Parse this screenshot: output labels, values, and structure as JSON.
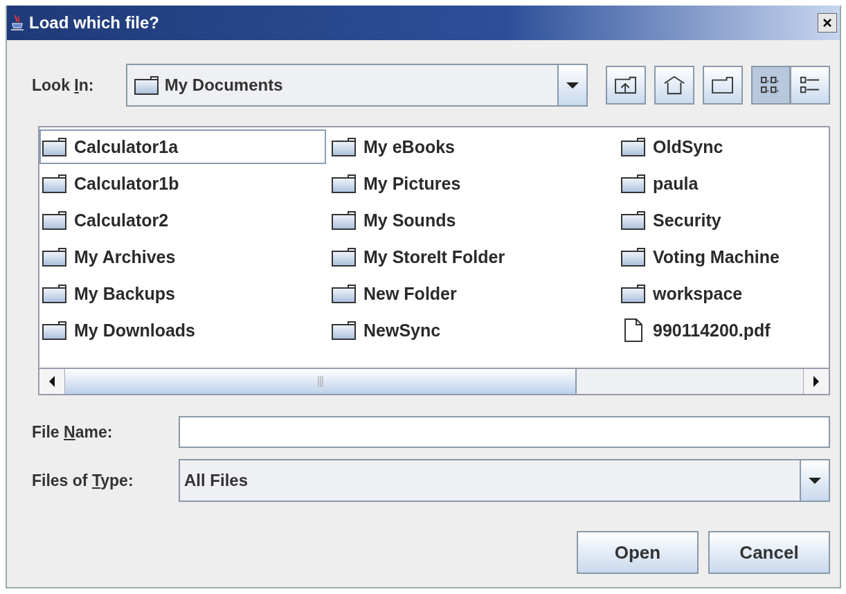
{
  "window": {
    "title": "Load which file?"
  },
  "look_in": {
    "label": {
      "before": "Look ",
      "key": "I",
      "after": "n:"
    },
    "value": "My Documents"
  },
  "toolbar": [
    {
      "kind": "up"
    },
    {
      "kind": "home"
    },
    {
      "kind": "new-folder"
    },
    {
      "kind": "list",
      "selected": true
    },
    {
      "kind": "details",
      "selected": false
    }
  ],
  "files": [
    {
      "name": "Calculator1a",
      "kind": "folder",
      "selected": true
    },
    {
      "name": "Calculator1b",
      "kind": "folder",
      "selected": false
    },
    {
      "name": "Calculator2",
      "kind": "folder",
      "selected": false
    },
    {
      "name": "My Archives",
      "kind": "folder",
      "selected": false
    },
    {
      "name": "My Backups",
      "kind": "folder",
      "selected": false
    },
    {
      "name": "My Downloads",
      "kind": "folder",
      "selected": false
    },
    {
      "name": "My eBooks",
      "kind": "folder",
      "selected": false
    },
    {
      "name": "My Pictures",
      "kind": "folder",
      "selected": false
    },
    {
      "name": "My Sounds",
      "kind": "folder",
      "selected": false
    },
    {
      "name": "My StoreIt Folder",
      "kind": "folder",
      "selected": false
    },
    {
      "name": "New Folder",
      "kind": "folder",
      "selected": false
    },
    {
      "name": "NewSync",
      "kind": "folder",
      "selected": false
    },
    {
      "name": "OldSync",
      "kind": "folder",
      "selected": false
    },
    {
      "name": "paula",
      "kind": "folder",
      "selected": false
    },
    {
      "name": "Security",
      "kind": "folder",
      "selected": false
    },
    {
      "name": "Voting Machine",
      "kind": "folder",
      "selected": false
    },
    {
      "name": "workspace",
      "kind": "folder",
      "selected": false
    },
    {
      "name": "990114200.pdf",
      "kind": "file",
      "selected": false
    }
  ],
  "file_name": {
    "label": {
      "before": "File ",
      "key": "N",
      "after": "ame:"
    }
  },
  "file_type": {
    "label": {
      "before": "Files of ",
      "key": "T",
      "after": "ype:"
    },
    "value": "All Files"
  },
  "buttons": [
    "Open",
    "Cancel"
  ]
}
